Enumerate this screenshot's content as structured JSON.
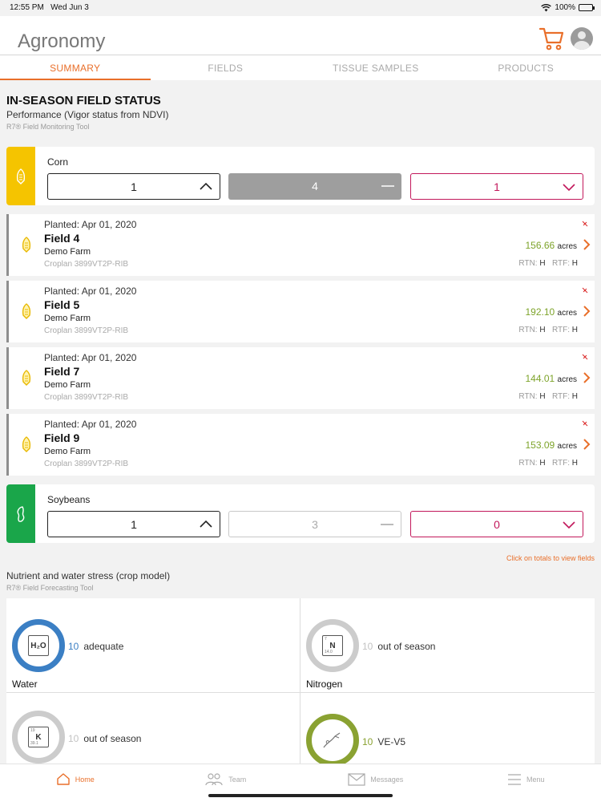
{
  "status_bar": {
    "time": "12:55 PM",
    "date": "Wed Jun 3",
    "battery": "100%"
  },
  "header": {
    "title": "Agronomy",
    "cart_icon": "cart-icon",
    "avatar_icon": "user-avatar-icon"
  },
  "tabs": [
    {
      "label": "SUMMARY",
      "active": true
    },
    {
      "label": "FIELDS",
      "active": false
    },
    {
      "label": "TISSUE SAMPLES",
      "active": false
    },
    {
      "label": "PRODUCTS",
      "active": false
    }
  ],
  "section": {
    "title": "IN-SEASON FIELD STATUS",
    "subtitle": "Performance (Vigor status from NDVI)",
    "tool": "R7® Field Monitoring Tool"
  },
  "crops": [
    {
      "name": "Corn",
      "color": "#f5c400",
      "up": "1",
      "flat": "4",
      "down": "1"
    },
    {
      "name": "Soybeans",
      "color": "#1aa64a",
      "up": "1",
      "flat": "3",
      "down": "0"
    }
  ],
  "fields": [
    {
      "planted": "Planted:  Apr 01, 2020",
      "name": "Field 4",
      "farm": "Demo Farm",
      "hybrid": "Croplan 3899VT2P-RIB",
      "acres": "156.66",
      "acres_unit": "acres",
      "rtn_label": "RTN:",
      "rtn": "H",
      "rtf_label": "RTF:",
      "rtf": "H"
    },
    {
      "planted": "Planted:  Apr 01, 2020",
      "name": "Field 5",
      "farm": "Demo Farm",
      "hybrid": "Croplan 3899VT2P-RIB",
      "acres": "192.10",
      "acres_unit": "acres",
      "rtn_label": "RTN:",
      "rtn": "H",
      "rtf_label": "RTF:",
      "rtf": "H"
    },
    {
      "planted": "Planted:  Apr 01, 2020",
      "name": "Field 7",
      "farm": "Demo Farm",
      "hybrid": "Croplan 3899VT2P-RIB",
      "acres": "144.01",
      "acres_unit": "acres",
      "rtn_label": "RTN:",
      "rtn": "H",
      "rtf_label": "RTF:",
      "rtf": "H"
    },
    {
      "planted": "Planted:  Apr 01, 2020",
      "name": "Field 9",
      "farm": "Demo Farm",
      "hybrid": "Croplan 3899VT2P-RIB",
      "acres": "153.09",
      "acres_unit": "acres",
      "rtn_label": "RTN:",
      "rtn": "H",
      "rtf_label": "RTF:",
      "rtf": "H"
    }
  ],
  "click_note": "Click on totals to view fields",
  "nutrient": {
    "title": "Nutrient and water stress (crop model)",
    "tool": "R7® Field Forecasting Tool",
    "cells": [
      {
        "name": "Water",
        "count": "10",
        "status": "adequate",
        "symbol": "H₂O",
        "ring_color": "#3b7fc4"
      },
      {
        "name": "Nitrogen",
        "count": "10",
        "status": "out of season",
        "symbol": "N",
        "atomic": "7",
        "mass": "14.0",
        "ring_color": "#cccccc"
      },
      {
        "name": "",
        "count": "10",
        "status": "out of season",
        "symbol": "K",
        "atomic": "19",
        "mass": "39.1",
        "ring_color": "#cccccc"
      },
      {
        "name": "",
        "count": "10",
        "status": "VE-V5",
        "symbol": "growth-stage-icon",
        "ring_color": "#8aa232"
      }
    ]
  },
  "bottom_nav": [
    {
      "label": "Home",
      "icon": "home-icon",
      "active": true
    },
    {
      "label": "Team",
      "icon": "team-icon",
      "active": false
    },
    {
      "label": "Messages",
      "icon": "messages-icon",
      "active": false
    },
    {
      "label": "Menu",
      "icon": "menu-icon",
      "active": false
    }
  ],
  "colors": {
    "accent": "#e96f2a",
    "acres": "#7da32a",
    "down": "#c2185b"
  }
}
